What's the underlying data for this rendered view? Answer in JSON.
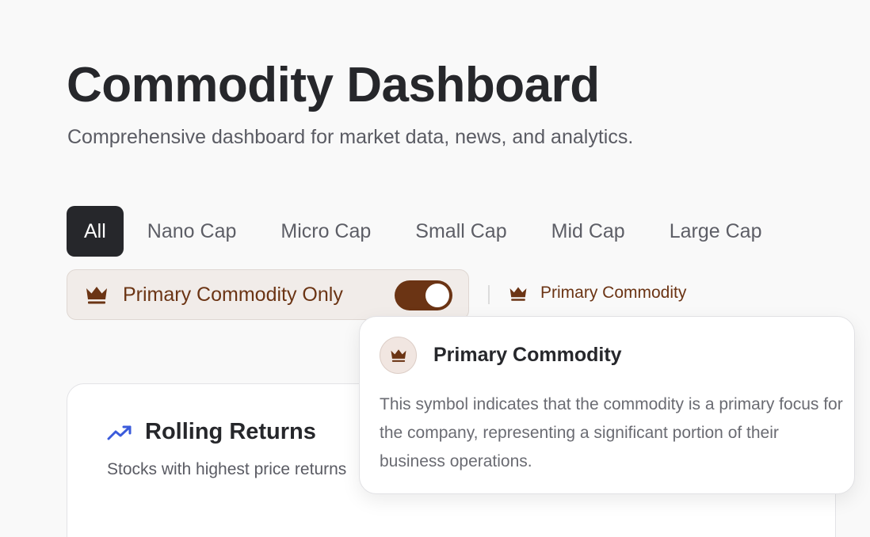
{
  "header": {
    "title": "Commodity Dashboard",
    "subtitle": "Comprehensive dashboard for market data, news, and analytics."
  },
  "tabs": [
    {
      "label": "All",
      "active": true
    },
    {
      "label": "Nano Cap",
      "active": false
    },
    {
      "label": "Micro Cap",
      "active": false
    },
    {
      "label": "Small Cap",
      "active": false
    },
    {
      "label": "Mid Cap",
      "active": false
    },
    {
      "label": "Large Cap",
      "active": false
    }
  ],
  "filter": {
    "label": "Primary Commodity Only",
    "icon": "crown-icon",
    "toggle_on": true
  },
  "legend": {
    "icon": "crown-icon",
    "label": "Primary Commodity"
  },
  "card": {
    "icon": "trending-up-icon",
    "title": "Rolling Returns",
    "description": "Stocks with highest price returns"
  },
  "tooltip": {
    "icon": "crown-icon",
    "title": "Primary Commodity",
    "body": "This symbol indicates that the commodity is a primary focus for the company, representing a significant portion of their business operations."
  },
  "colors": {
    "brand_brown": "#6b3414",
    "active_tab_bg": "#26272b",
    "trend_icon": "#3b5bdb"
  }
}
